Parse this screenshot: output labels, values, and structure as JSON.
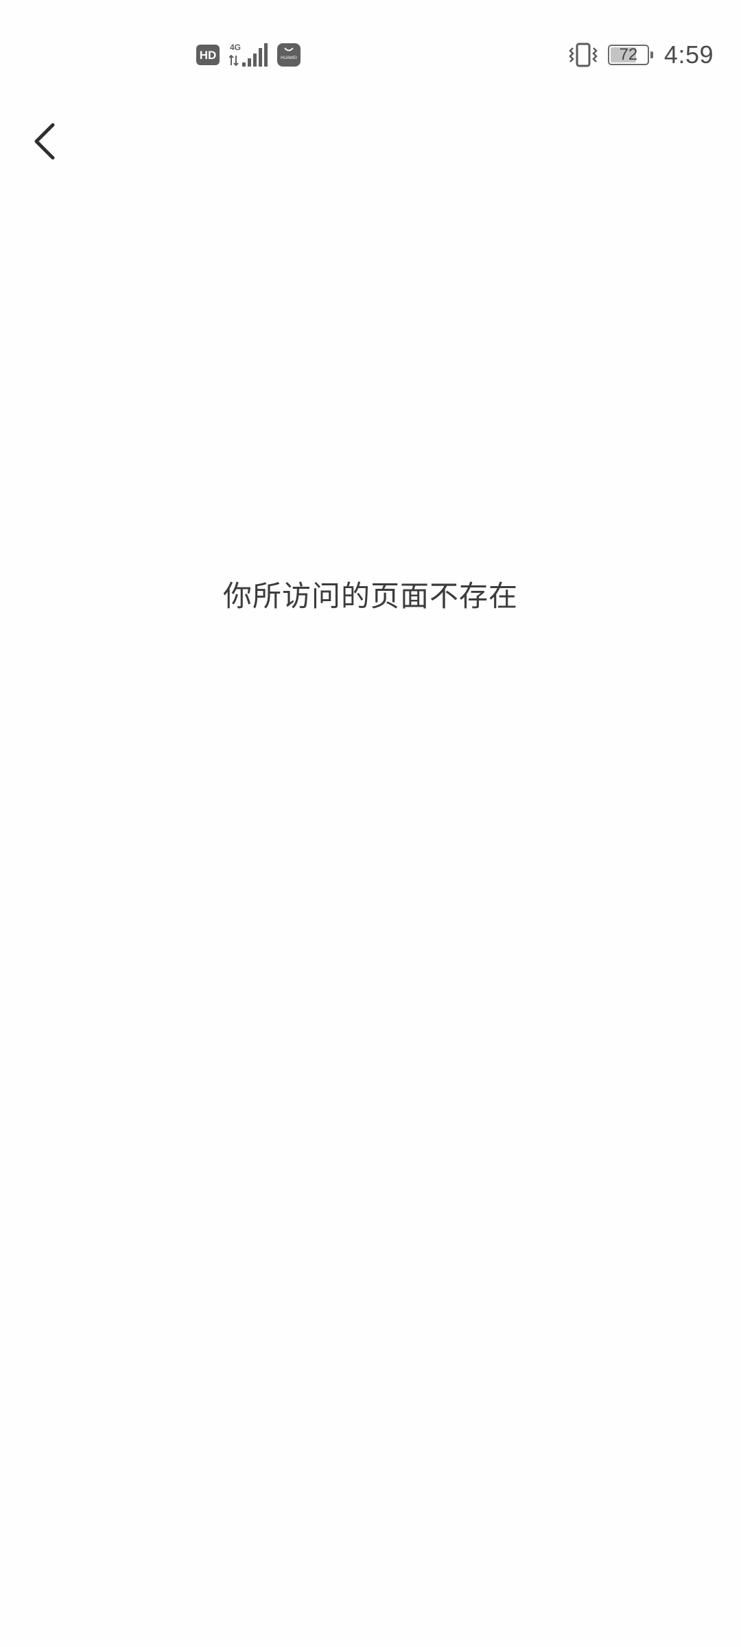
{
  "status_bar": {
    "left_icons": [
      "hd-icon",
      "signal-4g-icon",
      "huawei-appgallery-icon"
    ],
    "network_label": "4G",
    "hd_label": "HD",
    "store_label": "HUAWEI",
    "vibrate_icon": "vibrate-icon",
    "battery_level": "72",
    "battery_fraction": 0.72,
    "time": "4:59"
  },
  "nav": {
    "back_icon": "chevron-left-icon"
  },
  "main": {
    "message": "你所访问的页面不存在"
  }
}
